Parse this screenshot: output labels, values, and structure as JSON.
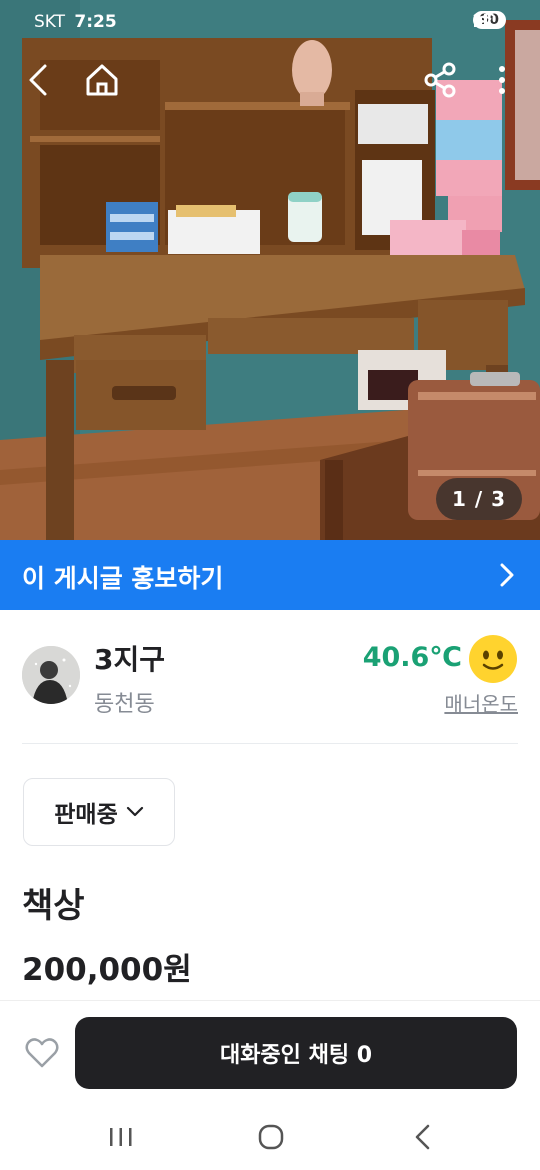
{
  "status_bar": {
    "carrier": "SKT",
    "time": "7:25",
    "battery": "90"
  },
  "photo": {
    "counter": "1 / 3"
  },
  "promo": {
    "label": "이 게시글 홍보하기"
  },
  "seller": {
    "name": "3지구",
    "location": "동천동",
    "temperature": "40.6℃",
    "temperature_label": "매너온도"
  },
  "sale_status": {
    "selected": "판매중"
  },
  "item": {
    "title": "책상",
    "price": "200,000원"
  },
  "actions": {
    "chat_label": "대화중인 채팅 0"
  },
  "colors": {
    "accent_blue": "#1a7df2",
    "temperature_green": "#1aa174",
    "chat_button": "#212124"
  },
  "icons": [
    "back-icon",
    "home-icon",
    "share-icon",
    "more-icon",
    "chevron-right-icon",
    "chevron-down-icon",
    "heart-icon",
    "smiley-icon",
    "recent-apps-icon",
    "home-circle-icon",
    "nav-back-icon"
  ]
}
